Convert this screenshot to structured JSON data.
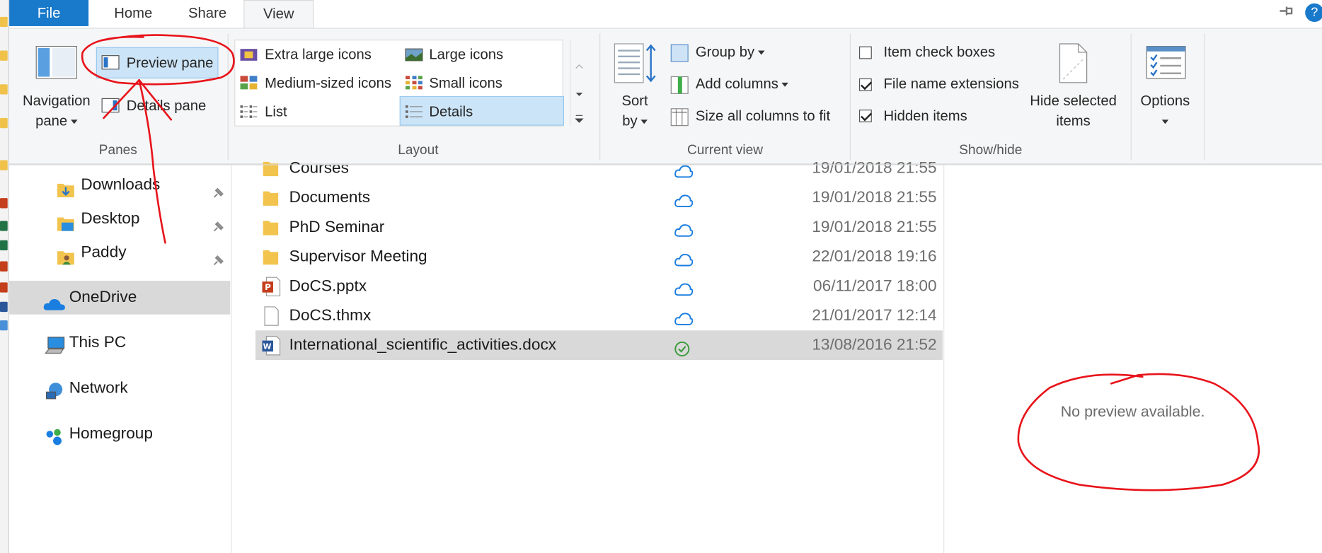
{
  "ribbon": {
    "tabs": [
      "File",
      "Home",
      "Share",
      "View"
    ],
    "panes": {
      "navigation_pane": [
        "Navigation",
        "pane"
      ],
      "preview_pane": "Preview pane",
      "details_pane": "Details pane",
      "group_label": "Panes"
    },
    "layout": {
      "extra_large_icons": "Extra large icons",
      "large_icons": "Large icons",
      "medium_icons": "Medium-sized icons",
      "small_icons": "Small icons",
      "list": "List",
      "details": "Details",
      "group_label": "Layout"
    },
    "current_view": {
      "sort_by": [
        "Sort",
        "by"
      ],
      "group_by": "Group by",
      "add_columns": "Add columns",
      "size_columns": "Size all columns to fit",
      "group_label": "Current view"
    },
    "show_hide": {
      "item_check_boxes": {
        "label": "Item check boxes",
        "checked": false
      },
      "file_name_extensions": {
        "label": "File name extensions",
        "checked": true
      },
      "hidden_items": {
        "label": "Hidden items",
        "checked": true
      },
      "hide_selected": [
        "Hide selected",
        "items"
      ],
      "group_label": "Show/hide"
    },
    "options": "Options"
  },
  "nav": {
    "quick_access": [
      {
        "label": "Downloads",
        "icon": "downloads-folder-icon"
      },
      {
        "label": "Desktop",
        "icon": "desktop-folder-icon"
      },
      {
        "label": "Paddy",
        "icon": "user-folder-icon"
      }
    ],
    "onedrive": "OneDrive",
    "this_pc": "This PC",
    "network": "Network",
    "homegroup": "Homegroup"
  },
  "files": [
    {
      "name": "Courses",
      "date": "19/01/2018 21:55",
      "type": "folder",
      "status": "cloud"
    },
    {
      "name": "Documents",
      "date": "19/01/2018 21:55",
      "type": "folder",
      "status": "cloud"
    },
    {
      "name": "PhD Seminar",
      "date": "19/01/2018 21:55",
      "type": "folder",
      "status": "cloud"
    },
    {
      "name": "Supervisor Meeting",
      "date": "22/01/2018 19:16",
      "type": "folder",
      "status": "cloud"
    },
    {
      "name": "DoCS.pptx",
      "date": "06/11/2017 18:00",
      "type": "pptx",
      "status": "cloud"
    },
    {
      "name": "DoCS.thmx",
      "date": "21/01/2017 12:14",
      "type": "file",
      "status": "cloud"
    },
    {
      "name": "International_scientific_activities.docx",
      "date": "13/08/2016 21:52",
      "type": "docx",
      "status": "synced"
    }
  ],
  "preview": {
    "message": "No preview available."
  },
  "colors": {
    "accent": "#1979ca",
    "selected": "#cce4f7",
    "row_selected": "#d9d9d9",
    "annotation": "#e8141b"
  }
}
